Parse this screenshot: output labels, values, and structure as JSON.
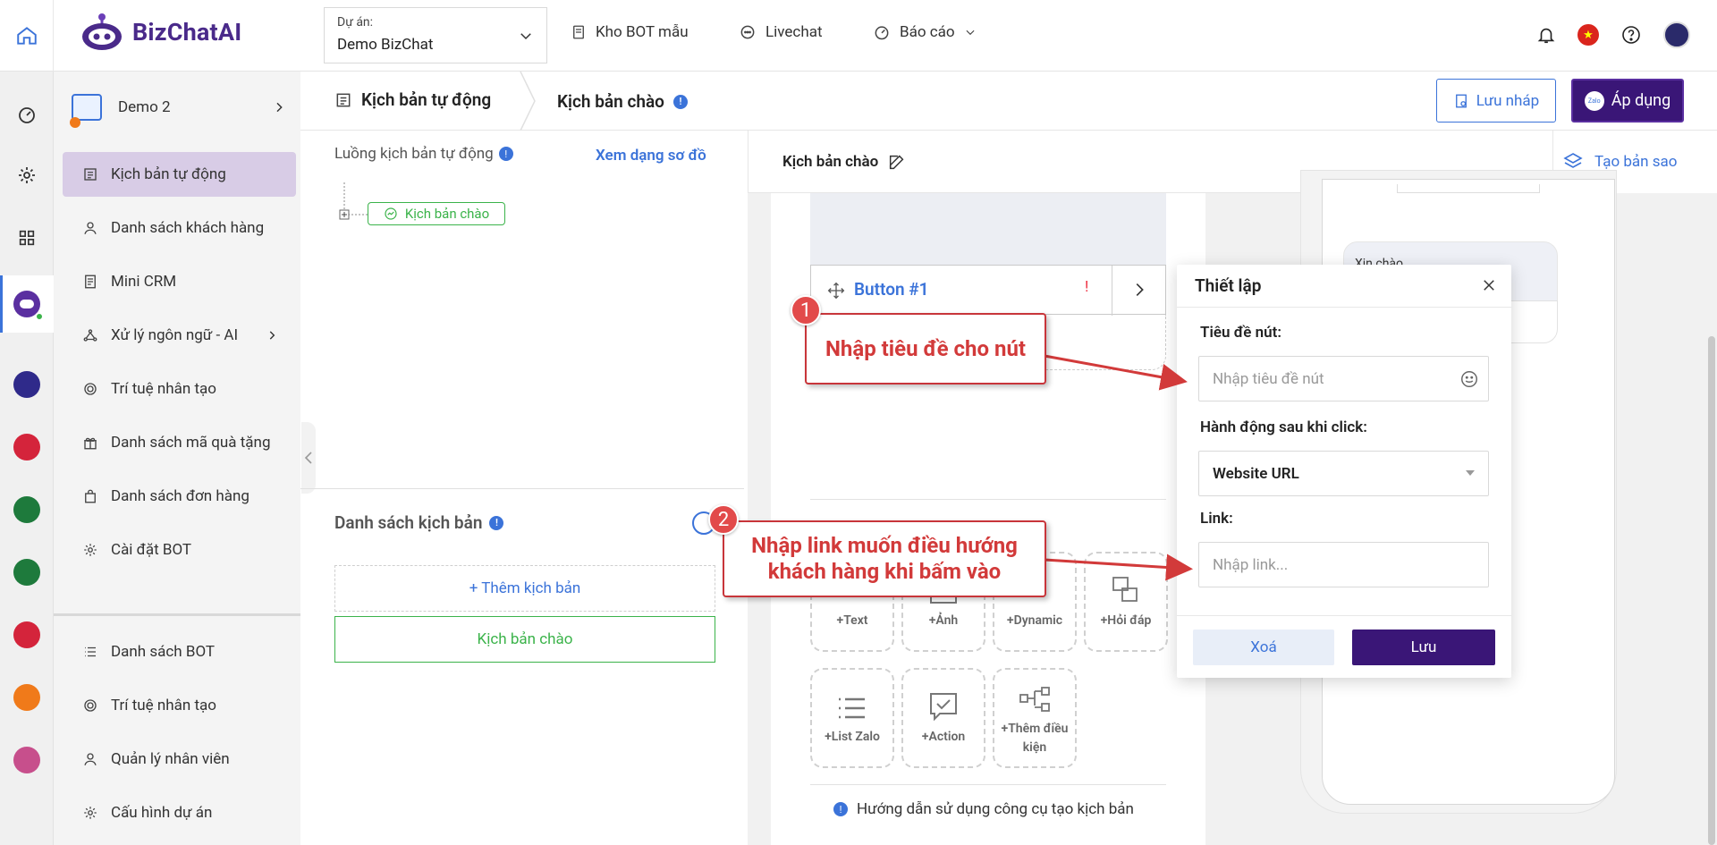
{
  "topbar": {
    "brand": "BizChatAI",
    "project_label": "Dự án:",
    "project_value": "Demo BizChat",
    "nav": [
      {
        "label": "Kho BOT mẫu"
      },
      {
        "label": "Livechat"
      },
      {
        "label": "Báo cáo"
      }
    ]
  },
  "sidebar": {
    "bot_name": "Demo 2",
    "items": [
      {
        "label": "Kịch bản tự động"
      },
      {
        "label": "Danh sách khách hàng"
      },
      {
        "label": "Mini CRM"
      },
      {
        "label": "Xử lý ngôn ngữ - AI"
      },
      {
        "label": "Trí tuệ nhân tạo"
      },
      {
        "label": "Danh sách mã quà tặng"
      },
      {
        "label": "Danh sách đơn hàng"
      },
      {
        "label": "Cài đặt BOT"
      }
    ],
    "bottom_items": [
      {
        "label": "Danh sách BOT"
      },
      {
        "label": "Trí tuệ nhân tạo"
      },
      {
        "label": "Quản lý nhân viên"
      },
      {
        "label": "Cấu hình dự án"
      }
    ]
  },
  "header": {
    "crumb1": "Kịch bản tự động",
    "crumb2": "Kịch bản chào",
    "save_draft": "Lưu nháp",
    "apply": "Áp dụng",
    "apply_badge": "Zalo"
  },
  "flow": {
    "title": "Luồng kịch bản tự động",
    "diagram_link": "Xem dạng sơ đồ",
    "node": "Kịch bản chào"
  },
  "script_list": {
    "title": "Danh sách kịch bản",
    "add": "+ Thêm kịch bản",
    "items": [
      "Kịch bản chào"
    ]
  },
  "editor": {
    "title": "Kịch bản chào",
    "copy": "Tạo bản sao",
    "button_label": "Button #1",
    "button_warning": "!",
    "tools": [
      {
        "label": "+Text"
      },
      {
        "label": "+Ảnh"
      },
      {
        "label": "+Dynamic"
      },
      {
        "label": "+Hỏi đáp"
      },
      {
        "label": "+List Zalo"
      },
      {
        "label": "+Action"
      },
      {
        "label": "+Thêm điều kiện"
      }
    ],
    "guide": "Hướng dẫn sử dụng công cụ tạo kịch bản"
  },
  "preview": {
    "bubble_text": "Xin chào"
  },
  "modal": {
    "title": "Thiết lập",
    "title_label": "Tiêu đề nút:",
    "title_placeholder": "Nhập tiêu đề nút",
    "action_label": "Hành động sau khi click:",
    "action_value": "Website URL",
    "link_label": "Link:",
    "link_placeholder": "Nhập link...",
    "delete": "Xoá",
    "save": "Lưu"
  },
  "annotations": {
    "step1_num": "1",
    "step1_text": "Nhập tiêu đề cho nút",
    "step2_num": "2",
    "step2_line1": "Nhập link muốn điều hướng",
    "step2_line2": "khách hàng khi bấm vào"
  },
  "colors": {
    "brand": "#3a1677",
    "link": "#3b73d9",
    "success": "#3bb34a",
    "annotation": "#d23a3a"
  }
}
